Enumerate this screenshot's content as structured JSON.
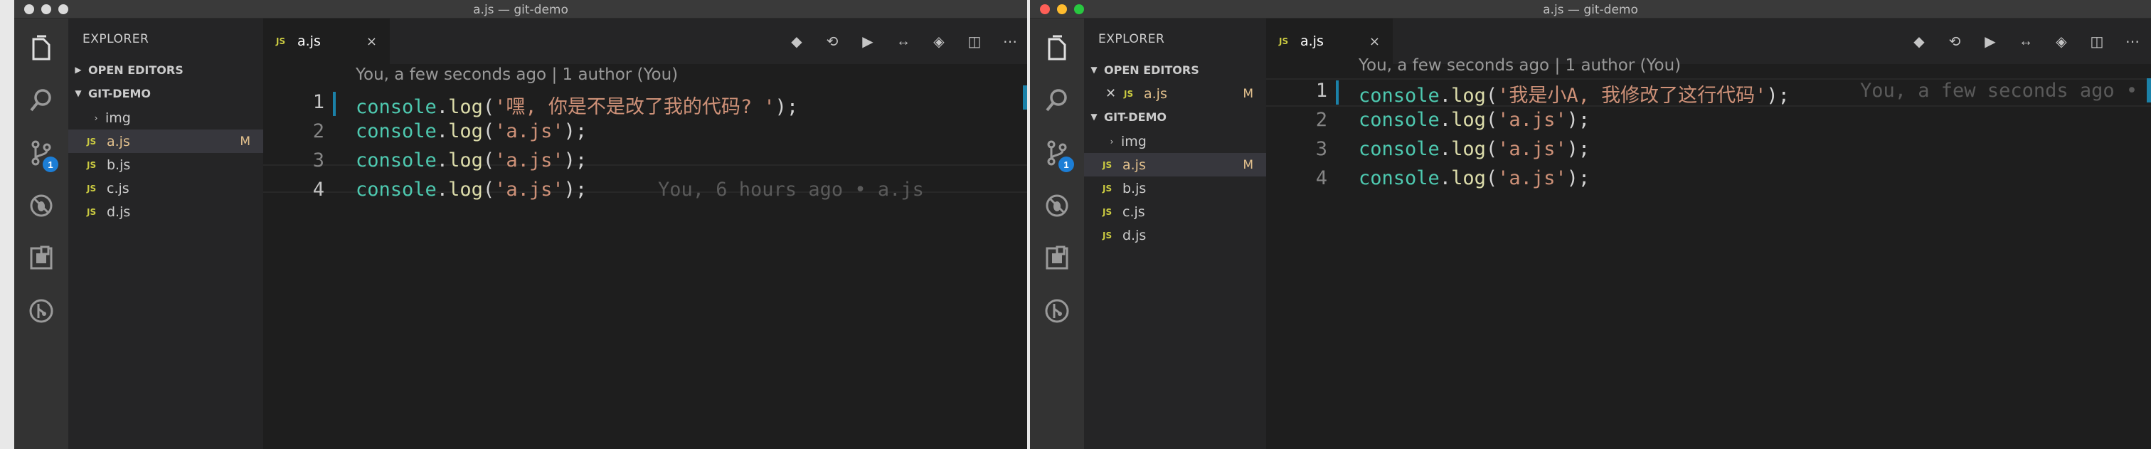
{
  "left": {
    "window_title": "a.js — git-demo",
    "sidebar": {
      "title": "EXPLORER",
      "open_editors_label": "OPEN EDITORS",
      "project_label": "GIT-DEMO",
      "files": [
        {
          "name": "img",
          "type": "folder"
        },
        {
          "name": "a.js",
          "type": "js",
          "status": "M"
        },
        {
          "name": "b.js",
          "type": "js"
        },
        {
          "name": "c.js",
          "type": "js"
        },
        {
          "name": "d.js",
          "type": "js"
        }
      ]
    },
    "tab": {
      "label": "a.js",
      "icon_label": "JS",
      "close": "×"
    },
    "blame_header": "You, a few seconds ago | 1 author (You)",
    "lines": [
      {
        "num": "1",
        "obj": "console",
        "dot": ".",
        "fn": "log",
        "open": "(",
        "str": "'嘿, 你是不是改了我的代码? '",
        "close": ");"
      },
      {
        "num": "2",
        "obj": "console",
        "dot": ".",
        "fn": "log",
        "open": "(",
        "str": "'a.js'",
        "close": ");"
      },
      {
        "num": "3",
        "obj": "console",
        "dot": ".",
        "fn": "log",
        "open": "(",
        "str": "'a.js'",
        "close": ");"
      },
      {
        "num": "4",
        "obj": "console",
        "dot": ".",
        "fn": "log",
        "open": "(",
        "str": "'a.js'",
        "close": ");"
      }
    ],
    "inline_blame": "You, 6 hours ago • a.js",
    "badge": "1"
  },
  "right": {
    "window_title": "a.js — git-demo",
    "sidebar": {
      "title": "EXPLORER",
      "open_editors_label": "OPEN EDITORS",
      "open_editor_file": "a.js",
      "open_editor_status": "M",
      "project_label": "GIT-DEMO",
      "files": [
        {
          "name": "img",
          "type": "folder"
        },
        {
          "name": "a.js",
          "type": "js",
          "status": "M"
        },
        {
          "name": "b.js",
          "type": "js"
        },
        {
          "name": "c.js",
          "type": "js"
        },
        {
          "name": "d.js",
          "type": "js"
        }
      ]
    },
    "tab": {
      "label": "a.js",
      "icon_label": "JS",
      "close": "×"
    },
    "blame_header": "You, a few seconds ago | 1 author (You)",
    "lines": [
      {
        "num": "1",
        "obj": "console",
        "dot": ".",
        "fn": "log",
        "open": "(",
        "str": "'我是小A, 我修改了这行代码'",
        "close": ");"
      },
      {
        "num": "2",
        "obj": "console",
        "dot": ".",
        "fn": "log",
        "open": "(",
        "str": "'a.js'",
        "close": ");"
      },
      {
        "num": "3",
        "obj": "console",
        "dot": ".",
        "fn": "log",
        "open": "(",
        "str": "'a.js'",
        "close": ");"
      },
      {
        "num": "4",
        "obj": "console",
        "dot": ".",
        "fn": "log",
        "open": "(",
        "str": "'a.js'",
        "close": ");"
      }
    ],
    "inline_blame": "You, a few seconds ago •",
    "badge": "1"
  },
  "icons": [
    "files-icon",
    "search-icon",
    "source-control-icon",
    "debug-icon",
    "extensions-icon",
    "gitlens-icon"
  ],
  "colors": {
    "editor_bg": "#1e1e1e",
    "sidebar_bg": "#252526",
    "activity_bg": "#333333",
    "badge": "#1c7ed6",
    "modified": "#e2c08d",
    "string": "#ce9178",
    "object": "#4ec9b0",
    "function": "#dcdcaa"
  }
}
